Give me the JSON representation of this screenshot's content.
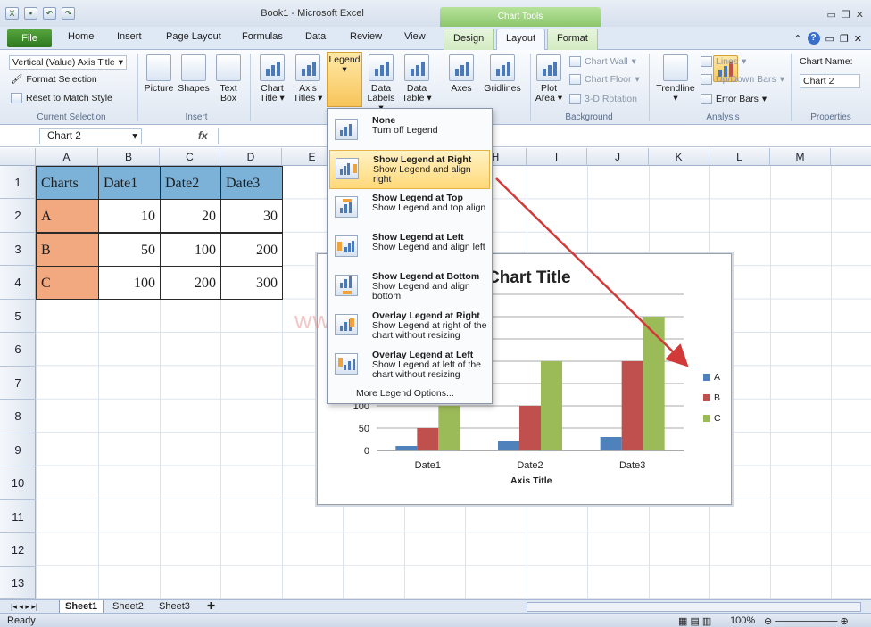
{
  "window": {
    "title": "Book1 - Microsoft Excel",
    "context_tab_group": "Chart Tools"
  },
  "tabs": {
    "file": "File",
    "home": "Home",
    "insert": "Insert",
    "page_layout": "Page Layout",
    "formulas": "Formulas",
    "data": "Data",
    "review": "Review",
    "view": "View",
    "design": "Design",
    "layout": "Layout",
    "format": "Format"
  },
  "ribbon": {
    "current_selection": {
      "dropdown": "Vertical (Value) Axis Title",
      "format_selection": "Format Selection",
      "reset": "Reset to Match Style",
      "label": "Current Selection"
    },
    "insert": {
      "picture": "Picture",
      "shapes": "Shapes",
      "text_box_1": "Text",
      "text_box_2": "Box",
      "label": "Insert"
    },
    "labels": {
      "chart_title_1": "Chart",
      "chart_title_2": "Title",
      "axis_titles_1": "Axis",
      "axis_titles_2": "Titles",
      "legend": "Legend",
      "data_labels_1": "Data",
      "data_labels_2": "Labels",
      "data_table_1": "Data",
      "data_table_2": "Table"
    },
    "axes": {
      "axes": "Axes",
      "gridlines": "Gridlines"
    },
    "background": {
      "plot_area_1": "Plot",
      "plot_area_2": "Area",
      "chart_wall": "Chart Wall",
      "chart_floor": "Chart Floor",
      "rotation": "3-D Rotation",
      "label": "Background"
    },
    "analysis": {
      "trendline": "Trendline",
      "lines": "Lines",
      "updown": "Up/Down Bars",
      "error_bars": "Error Bars",
      "label": "Analysis"
    },
    "properties": {
      "chart_name_label": "Chart Name:",
      "chart_name_value": "Chart 2",
      "label": "Properties"
    }
  },
  "formula_bar": {
    "name_box": "Chart 2",
    "fx": "fx"
  },
  "columns": [
    "A",
    "B",
    "C",
    "D",
    "E",
    "F",
    "G",
    "H",
    "I",
    "J",
    "K",
    "L",
    "M"
  ],
  "rows": [
    "1",
    "2",
    "3",
    "4",
    "5",
    "6",
    "7",
    "8",
    "9",
    "10",
    "11",
    "12",
    "13"
  ],
  "sheet_table": {
    "header": [
      "Charts",
      "Date1",
      "Date2",
      "Date3"
    ],
    "rows": [
      {
        "label": "A",
        "values": [
          "10",
          "20",
          "30"
        ]
      },
      {
        "label": "B",
        "values": [
          "50",
          "100",
          "200"
        ]
      },
      {
        "label": "C",
        "values": [
          "100",
          "200",
          "300"
        ]
      }
    ]
  },
  "watermark": "www.     T.com",
  "legend_menu": {
    "items": [
      {
        "title": "None",
        "desc": "Turn off Legend"
      },
      {
        "title": "Show Legend at Right",
        "desc": "Show Legend and align right"
      },
      {
        "title": "Show Legend at Top",
        "desc": "Show Legend and top align"
      },
      {
        "title": "Show Legend at Left",
        "desc": "Show Legend and align left"
      },
      {
        "title": "Show Legend at Bottom",
        "desc": "Show Legend and align bottom"
      },
      {
        "title": "Overlay Legend at Right",
        "desc": "Show Legend at right of the chart without resizing"
      },
      {
        "title": "Overlay Legend at Left",
        "desc": "Show Legend at left of the chart without resizing"
      }
    ],
    "more": "More Legend Options...",
    "selected_index": 1
  },
  "chart_data": {
    "type": "bar",
    "title": "Chart Title",
    "xlabel": "Axis Title",
    "ylabel": "",
    "categories": [
      "Date1",
      "Date2",
      "Date3"
    ],
    "series": [
      {
        "name": "A",
        "values": [
          10,
          20,
          30
        ],
        "color": "#4f81bd"
      },
      {
        "name": "B",
        "values": [
          50,
          100,
          200
        ],
        "color": "#c0504d"
      },
      {
        "name": "C",
        "values": [
          100,
          200,
          300
        ],
        "color": "#9bbb59"
      }
    ],
    "ylim": [
      0,
      350
    ],
    "visible_ticks": [
      "0",
      "50",
      "100"
    ],
    "legend_position": "right",
    "grid": true
  },
  "sheets": [
    "Sheet1",
    "Sheet2",
    "Sheet3"
  ],
  "status": {
    "ready": "Ready",
    "zoom": "100%"
  },
  "colors": {
    "accent_green": "#2f7a1f",
    "highlight": "#ffd97a",
    "arrow": "#d23a3a"
  }
}
